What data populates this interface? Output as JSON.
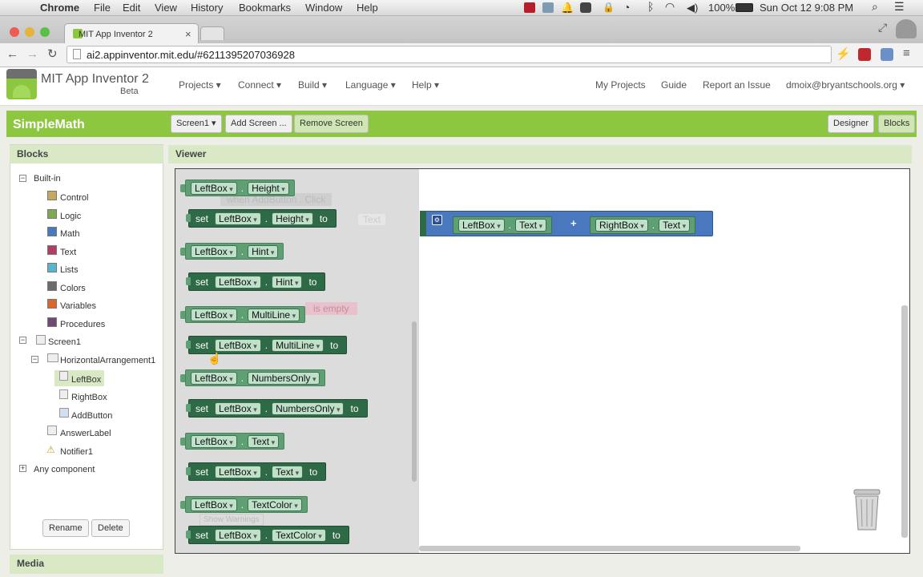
{
  "mac_menubar": {
    "app_name": "Chrome",
    "menus": [
      "File",
      "Edit",
      "View",
      "History",
      "Bookmarks",
      "Window",
      "Help"
    ],
    "battery": "100%",
    "clock": "Sun Oct 12  9:08 PM"
  },
  "browser": {
    "tab_title": "MIT App Inventor 2",
    "tab_close": "×",
    "url": "ai2.appinventor.mit.edu/#6211395207036928"
  },
  "app_header": {
    "title": "MIT App Inventor 2",
    "subtitle": "Beta",
    "nav": [
      "Projects ▾",
      "Connect ▾",
      "Build ▾",
      "Language ▾",
      "Help ▾"
    ],
    "links": [
      "My Projects",
      "Guide",
      "Report an Issue"
    ],
    "account": "dmoix@bryantschools.org ▾"
  },
  "project_bar": {
    "project_name": "SimpleMath",
    "screen_select": "Screen1 ▾",
    "add_screen": "Add Screen ...",
    "remove_screen": "Remove Screen",
    "designer": "Designer",
    "blocks": "Blocks"
  },
  "blocks_panel": {
    "title": "Blocks",
    "builtin_label": "Built-in",
    "builtin": [
      {
        "label": "Control",
        "color": "#c9a75e"
      },
      {
        "label": "Logic",
        "color": "#7eaa4f"
      },
      {
        "label": "Math",
        "color": "#4a78bf"
      },
      {
        "label": "Text",
        "color": "#b43a67"
      },
      {
        "label": "Lists",
        "color": "#58b5cf"
      },
      {
        "label": "Colors",
        "color": "#6b6b6b"
      },
      {
        "label": "Variables",
        "color": "#d9682e"
      },
      {
        "label": "Procedures",
        "color": "#6e4a74"
      }
    ],
    "screen": "Screen1",
    "arrangement": "HorizontalArrangement1",
    "components": [
      "LeftBox",
      "RightBox",
      "AddButton"
    ],
    "screen_children": [
      "AnswerLabel",
      "Notifier1"
    ],
    "any_component": "Any component",
    "rename": "Rename",
    "delete": "Delete"
  },
  "media_panel": {
    "title": "Media"
  },
  "viewer": {
    "title": "Viewer",
    "flyout_blocks": [
      {
        "kind": "get",
        "component": "LeftBox",
        "property": "Height"
      },
      {
        "kind": "set",
        "component": "LeftBox",
        "property": "Height"
      },
      {
        "kind": "get",
        "component": "LeftBox",
        "property": "Hint"
      },
      {
        "kind": "set",
        "component": "LeftBox",
        "property": "Hint"
      },
      {
        "kind": "get",
        "component": "LeftBox",
        "property": "MultiLine"
      },
      {
        "kind": "set",
        "component": "LeftBox",
        "property": "MultiLine"
      },
      {
        "kind": "get",
        "component": "LeftBox",
        "property": "NumbersOnly"
      },
      {
        "kind": "set",
        "component": "LeftBox",
        "property": "NumbersOnly"
      },
      {
        "kind": "get",
        "component": "LeftBox",
        "property": "Text"
      },
      {
        "kind": "set",
        "component": "LeftBox",
        "property": "Text"
      },
      {
        "kind": "get",
        "component": "LeftBox",
        "property": "TextColor"
      },
      {
        "kind": "set",
        "component": "LeftBox",
        "property": "TextColor"
      }
    ],
    "set_word": "set",
    "to_word": "to",
    "dot": ".",
    "ghost_event": "when  AddButton  . Click",
    "ghost_text": "Text",
    "ghost_empty": "is empty",
    "ghost_warnings": "Show Warnings",
    "join_block": {
      "left_component": "LeftBox",
      "left_property": "Text",
      "operator": "+",
      "right_component": "RightBox",
      "right_property": "Text"
    }
  }
}
